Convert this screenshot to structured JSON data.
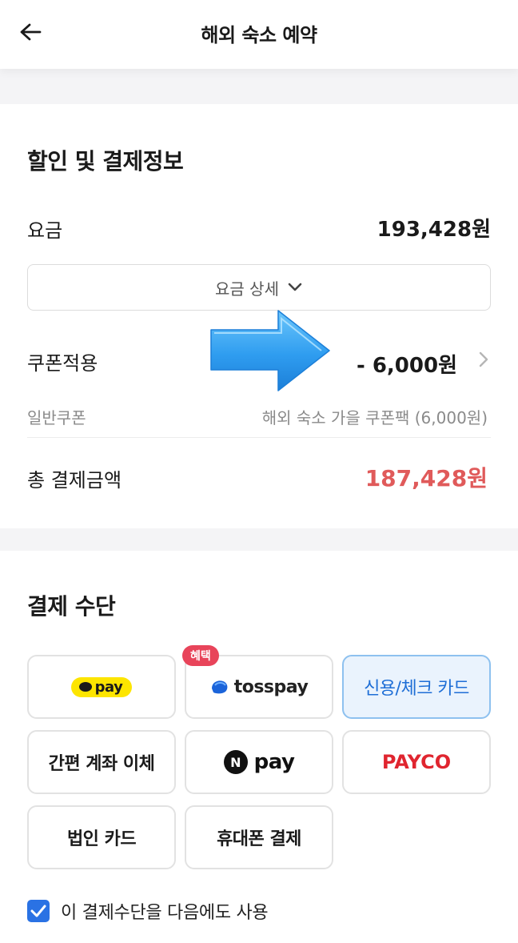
{
  "header": {
    "title": "해외 숙소 예약"
  },
  "discount": {
    "section_title": "할인 및 결제정보",
    "fee_label": "요금",
    "fee_value": "193,428원",
    "fee_detail_label": "요금 상세",
    "coupon_label": "쿠폰적용",
    "coupon_value": "- 6,000원",
    "general_coupon_label": "일반쿠폰",
    "general_coupon_value": "해외 숙소 가을 쿠폰팩 (6,000원)",
    "total_label": "총 결제금액",
    "total_value": "187,428원"
  },
  "payment": {
    "section_title": "결제 수단",
    "kakao_label": "pay",
    "toss_label_bold": "toss",
    "toss_label_rest": "pay",
    "toss_badge": "혜택",
    "card_label": "신용/체크 카드",
    "bank_label": "간편 계좌 이체",
    "npay_n": "N",
    "npay_label": "pay",
    "payco_label": "PAYCO",
    "corporate_label": "법인 카드",
    "mobile_label": "휴대폰 결제",
    "remember_label": "이 결제수단을 다음에도 사용",
    "remember_checked": true
  },
  "colors": {
    "total_red": "#e05a5a",
    "selected_blue": "#1e6ed6",
    "arrow_blue": "#3aa3f0",
    "kakao_yellow": "#fde500",
    "badge_red": "#e8445a",
    "payco_red": "#e0252f"
  },
  "icons": {
    "back": "arrow-left-icon",
    "fee_detail": "chevron-down-icon",
    "coupon": "chevron-right-icon",
    "annotation": "arrow-right-icon",
    "check": "checkmark-icon"
  }
}
